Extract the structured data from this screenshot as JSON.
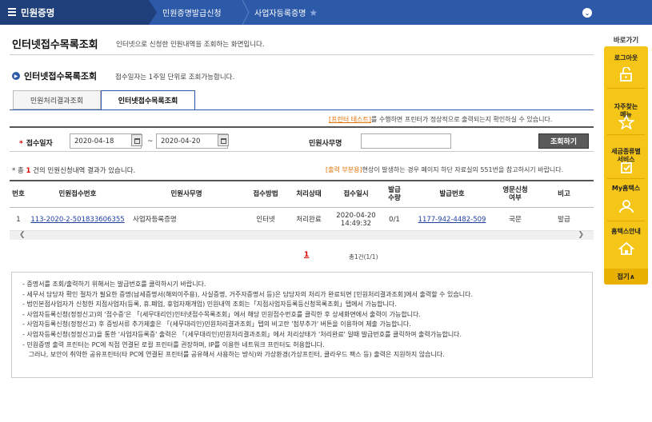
{
  "topbar": {
    "menu": "민원증명",
    "crumb1": "민원증명발급신청",
    "crumb2": "사업자등록증명"
  },
  "page": {
    "title": "인터넷접수목록조회",
    "desc": "인터넷으로 신청한 민원내역을 조회하는 화면입니다.",
    "sub_title": "인터넷접수목록조회",
    "sub_desc": "접수일자는 1주일 단위로 조회가능합니다."
  },
  "tabs": [
    {
      "label": "민원처리결과조회"
    },
    {
      "label": "인터넷접수목록조회"
    }
  ],
  "notice_printer": {
    "highlight": "[프린터 테스트]",
    "text": "를 수행하면 프린터가 정상적으로 출력되는지 확인하실 수 있습니다."
  },
  "search": {
    "date_label": "접수일자",
    "required_mark": "*",
    "date_from": "2020-04-18",
    "tilde": "~",
    "date_to": "2020-04-20",
    "office_label": "민원사무명",
    "office_value": "",
    "button": "조회하기"
  },
  "results": {
    "count_prefix": "* 총",
    "count": "1",
    "count_suffix": "건의 민원신청내역 결과가 있습니다.",
    "notice_highlight": "[출력 부분용]",
    "notice_text": "현상이 발생하는 경우 페이지 하단 자료실의 551번을 참고하시기 바랍니다."
  },
  "table": {
    "headers": [
      "번호",
      "민원접수번호",
      "민원사무명",
      "접수방법",
      "처리상태",
      "접수일시",
      "발급\n수량",
      "발급번호",
      "영문신청\n여부",
      "비고"
    ],
    "rows": [
      {
        "no": "1",
        "receipt_no": "113-2020-2-501833606355",
        "office": "사업자등록증명",
        "method": "인터넷",
        "status": "처리완료",
        "date": "2020-04-20",
        "time": "14:49:32",
        "qty": "0/1",
        "issue_no": "1177-942-4482-509",
        "english": "국문",
        "note": "발급"
      }
    ]
  },
  "pager": {
    "current": "1",
    "total": "총1건(1/1)"
  },
  "info_lines": [
    "- 증명서를 조회/출력하기 위해서는 발급번호를 클릭하시기 바랍니다.",
    "- 세무서 담당자 확인 절차가 필요한 증명(납세증명서(해외이주용), 사실증명, 거주자증명서 등)은 담당자의 처리가 완료되면 [민원처리결과조회]에서 출력할 수 있습니다.",
    "- 법인본점사업자가 신청한 지점사업자(등록, 휴.폐업, 휴업자재개업) 민원내역 조회는「지점사업자등록등신청목록조회」탭에서 가능합니다.",
    "- 사업자등록신청(정정신고)의 '접수증'은 「(세무대리인)인터넷접수목록조회」에서 해당 민원접수번호를 클릭한 후 상세화면에서 출력이 가능합니다.",
    "- 사업자등록신청(정정신고) 후 증빙서류 추가제출은 「(세무대리인)민원처리결과조회」탭의 비고란 '첨부추가' 버튼을 이용하여 제출 가능합니다.",
    "- 사업자등록신청(정정신고)을 통한 '사업자등록증' 출력은 「(세무대리인)민원처리결과조회」에서 처리상태가 '처리완료' 일때 발급번호를 클릭하여 출력가능합니다.",
    "- 민원증명 출력 프린터는 PC에 직접 연결된 로컬 프린터를 권장하며, IP를 이용한 네트워크 프린터도 허용합니다.",
    "   그러나, 보안이 취약한 공유프린터(타 PC에 연결된 프린터를 공유해서 사용하는 방식)와 가상환경(가상프린터, 클라우드 팩스 등) 출력은 지원하지 않습니다."
  ],
  "quick_menu": {
    "title": "바로가기",
    "items": [
      {
        "label": "로그아웃",
        "icon": "logout-icon"
      },
      {
        "label": "자주찾는\n메뉴",
        "icon": "star-icon"
      },
      {
        "label": "세금종류별\n서비스",
        "icon": "checkbox-icon"
      },
      {
        "label": "My홈택스",
        "icon": "person-icon"
      },
      {
        "label": "홈택스안내",
        "icon": "home-icon"
      }
    ],
    "close": "접기∧"
  }
}
